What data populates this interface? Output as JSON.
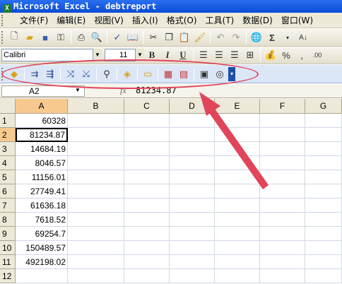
{
  "window": {
    "title": "Microsoft Excel - debtreport"
  },
  "menu": [
    "文件(F)",
    "编辑(E)",
    "视图(V)",
    "插入(I)",
    "格式(O)",
    "工具(T)",
    "数据(D)",
    "窗口(W)"
  ],
  "format_toolbar": {
    "font": "Calibri",
    "size": "11",
    "bold": "B",
    "italic": "I",
    "underline": "U",
    "percent": "%"
  },
  "formula_bar": {
    "name_box": "A2",
    "fx": "fx",
    "value": "81234.87"
  },
  "columns": [
    "A",
    "B",
    "C",
    "D",
    "E",
    "F",
    "G"
  ],
  "rows": [
    "1",
    "2",
    "3",
    "4",
    "5",
    "6",
    "7",
    "8",
    "9",
    "10",
    "11",
    "12"
  ],
  "column_a_values": [
    "60328",
    "81234.87",
    "14684.19",
    "8046.57",
    "11156.01",
    "27749.41",
    "61636.18",
    "7618.52",
    "69254.7",
    "150489.57",
    "492198.02",
    ""
  ],
  "active_cell": "A2",
  "colors": {
    "highlight": "#e0455a",
    "title_bar": "#0a4bd6",
    "selected_header": "#f8c98f"
  }
}
